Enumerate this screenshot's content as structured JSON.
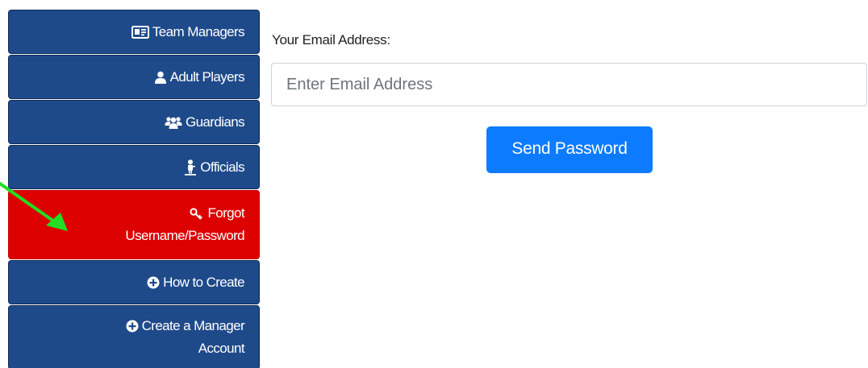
{
  "sidebar": {
    "items": [
      {
        "label": "Team Managers",
        "icon": "id-card-icon"
      },
      {
        "label": "Adult Players",
        "icon": "user-icon"
      },
      {
        "label": "Guardians",
        "icon": "users-icon"
      },
      {
        "label": "Officials",
        "icon": "referee-icon"
      },
      {
        "label_line1": "Forgot",
        "label_line2": "Username/Password",
        "icon": "key-icon",
        "active": true
      },
      {
        "label": "How to Create",
        "icon": "plus-circle-icon"
      },
      {
        "label_line1": "Create a Manager",
        "label_line2": "Account",
        "icon": "plus-circle-icon"
      }
    ]
  },
  "form": {
    "email_label": "Your Email Address:",
    "email_placeholder": "Enter Email Address",
    "email_value": "",
    "send_button": "Send Password"
  },
  "colors": {
    "nav_bg": "#1f4a8a",
    "nav_active_bg": "#dd0000",
    "button_bg": "#0d7bff",
    "annotation_arrow": "#22dd22"
  }
}
